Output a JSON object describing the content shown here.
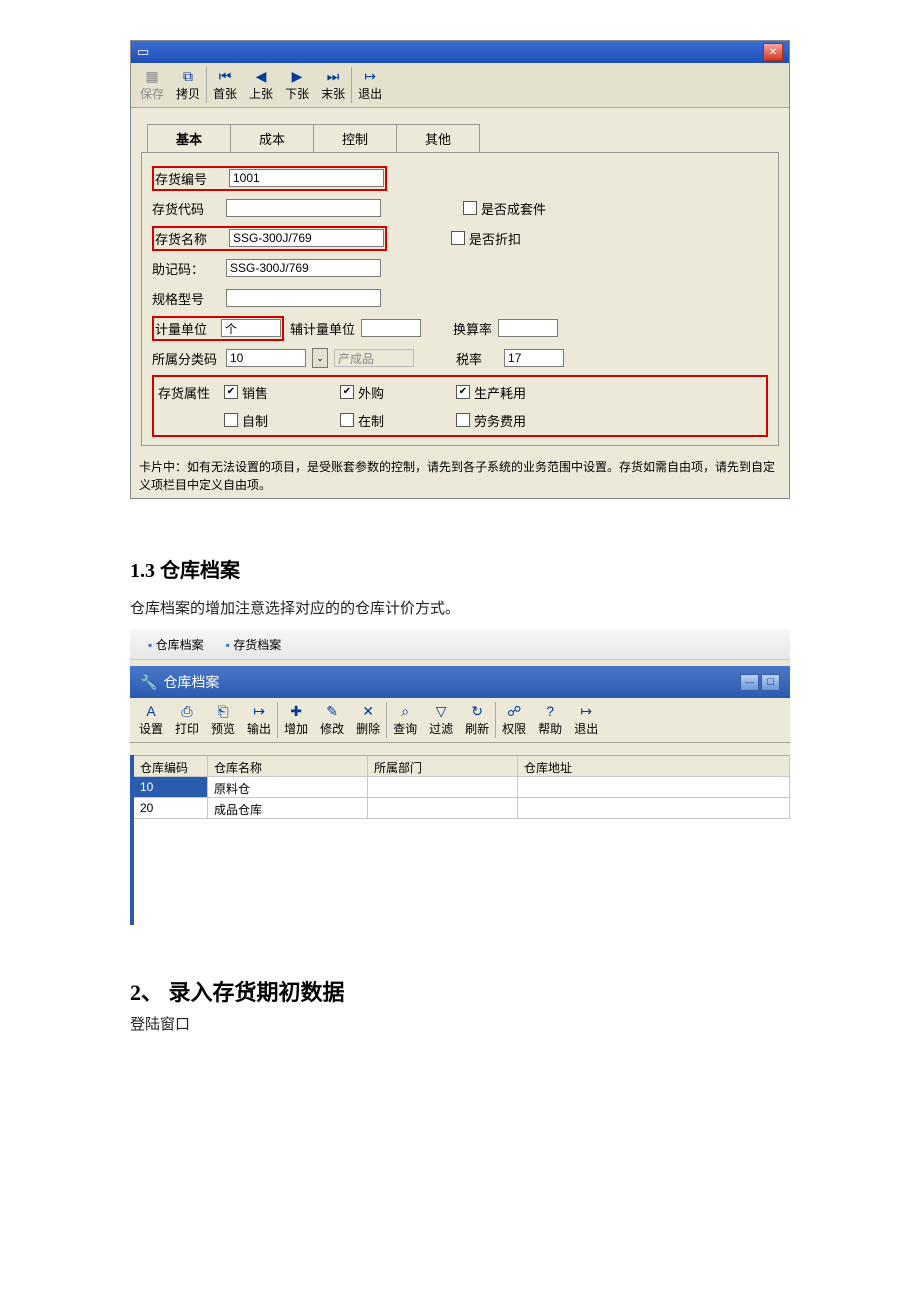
{
  "win1": {
    "toolbar": [
      {
        "i": "▦",
        "l": "保存",
        "d": true
      },
      {
        "i": "⧉",
        "l": "拷贝"
      },
      {
        "sep": true
      },
      {
        "i": "⏮",
        "l": "首张"
      },
      {
        "i": "◀",
        "l": "上张"
      },
      {
        "i": "▶",
        "l": "下张"
      },
      {
        "i": "⏭",
        "l": "末张"
      },
      {
        "sep": true
      },
      {
        "i": "↦",
        "l": "退出"
      }
    ],
    "tabs": [
      "基本",
      "成本",
      "控制",
      "其他"
    ],
    "fields": {
      "code_label": "存货编号",
      "code": "1001",
      "code2_label": "存货代码",
      "code2": "",
      "name_label": "存货名称",
      "name": "SSG-300J/769",
      "mnemonic_label": "助记码：",
      "mnemonic": "SSG-300J/769",
      "spec_label": "规格型号",
      "unit_label": "计量单位",
      "unit": "个",
      "aux_unit_label": "辅计量单位",
      "rate_label": "换算率",
      "class_label": "所属分类码",
      "class": "10",
      "class_name": "产成品",
      "tax_label": "税率",
      "tax": "17",
      "attr_label": "存货属性",
      "cb_kit": "是否成套件",
      "cb_disc": "是否折扣",
      "cb_sale": "销售",
      "cb_buy": "外购",
      "cb_prod": "生产耗用",
      "cb_self": "自制",
      "cb_wip": "在制",
      "cb_labor": "劳务费用"
    },
    "hint": "卡片中：如有无法设置的项目，是受账套参数的控制，请先到各子系统的业务范围中设置。存货如需自由项，请先到自定义项栏目中定义自由项。"
  },
  "doc": {
    "h1": "1.3 仓库档案",
    "p1": "仓库档案的增加注意选择对应的的仓库计价方式。",
    "h2": "2、   录入存货期初数据",
    "p2": "登陆窗口"
  },
  "win2": {
    "crumbs": [
      "仓库档案",
      "存货档案"
    ],
    "title": "仓库档案",
    "toolbar": [
      {
        "i": "A",
        "l": "设置"
      },
      {
        "i": "⎙",
        "l": "打印"
      },
      {
        "i": "⎗",
        "l": "预览"
      },
      {
        "i": "↦",
        "l": "输出"
      },
      {
        "sep": true
      },
      {
        "i": "✚",
        "l": "增加"
      },
      {
        "i": "✎",
        "l": "修改"
      },
      {
        "i": "✕",
        "l": "删除"
      },
      {
        "sep": true
      },
      {
        "i": "⌕",
        "l": "查询"
      },
      {
        "i": "▽",
        "l": "过滤"
      },
      {
        "i": "↻",
        "l": "刷新"
      },
      {
        "sep": true
      },
      {
        "i": "☍",
        "l": "权限"
      },
      {
        "i": "?",
        "l": "帮助"
      },
      {
        "i": "↦",
        "l": "退出"
      }
    ],
    "cols": [
      "仓库编码",
      "仓库名称",
      "所属部门",
      "仓库地址"
    ],
    "rows": [
      {
        "c": "10",
        "n": "原料仓",
        "d": "",
        "a": ""
      },
      {
        "c": "20",
        "n": "成品仓库",
        "d": "",
        "a": ""
      }
    ]
  }
}
